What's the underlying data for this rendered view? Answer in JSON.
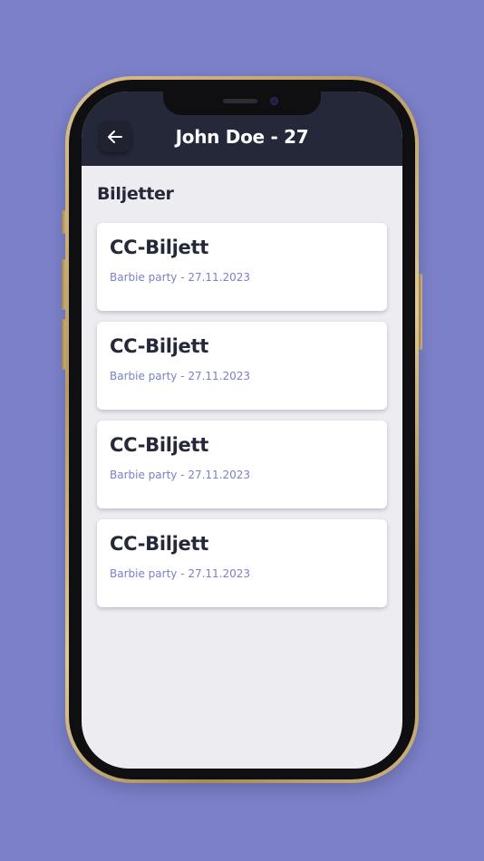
{
  "colors": {
    "background": "#7b80c9",
    "header": "#242838",
    "screen": "#ececf1",
    "card": "#ffffff",
    "accent_text": "#7b80c9",
    "title_text": "#242838"
  },
  "header": {
    "title": "John Doe - 27",
    "back_icon": "arrow-left-icon"
  },
  "section": {
    "title": "Biljetter"
  },
  "tickets": [
    {
      "title": "CC-Biljett",
      "subtitle": "Barbie party - 27.11.2023"
    },
    {
      "title": "CC-Biljett",
      "subtitle": "Barbie party - 27.11.2023"
    },
    {
      "title": "CC-Biljett",
      "subtitle": "Barbie party - 27.11.2023"
    },
    {
      "title": "CC-Biljett",
      "subtitle": "Barbie party - 27.11.2023"
    }
  ]
}
